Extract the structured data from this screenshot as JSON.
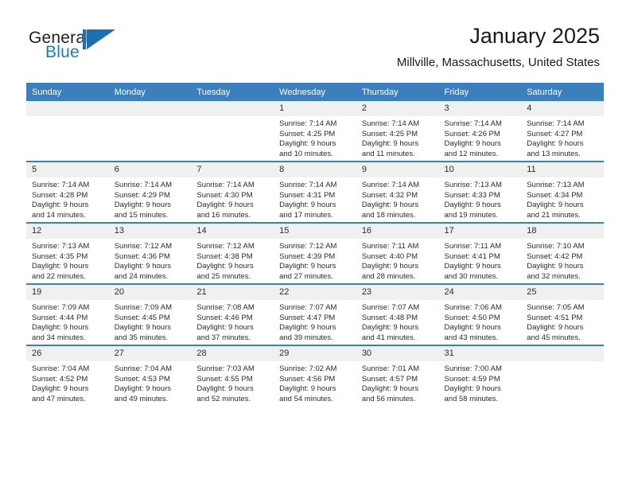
{
  "brand": {
    "name_part1": "General",
    "name_part2": "Blue",
    "logo_icon": "blue-triangle-flag-icon",
    "accent_color": "#1c7cc4"
  },
  "header": {
    "title": "January 2025",
    "subtitle": "Millville, Massachusetts, United States",
    "header_bg_color": "#3b7fbf",
    "daynum_bg_color": "#f0f0f0"
  },
  "weekday_headers": [
    "Sunday",
    "Monday",
    "Tuesday",
    "Wednesday",
    "Thursday",
    "Friday",
    "Saturday"
  ],
  "weeks": [
    [
      {
        "day": "",
        "empty": true,
        "sunrise": "",
        "sunset": "",
        "daylight_line1": "",
        "daylight_line2": ""
      },
      {
        "day": "",
        "empty": true,
        "sunrise": "",
        "sunset": "",
        "daylight_line1": "",
        "daylight_line2": ""
      },
      {
        "day": "",
        "empty": true,
        "sunrise": "",
        "sunset": "",
        "daylight_line1": "",
        "daylight_line2": ""
      },
      {
        "day": "1",
        "empty": false,
        "sunrise": "Sunrise: 7:14 AM",
        "sunset": "Sunset: 4:25 PM",
        "daylight_line1": "Daylight: 9 hours",
        "daylight_line2": "and 10 minutes."
      },
      {
        "day": "2",
        "empty": false,
        "sunrise": "Sunrise: 7:14 AM",
        "sunset": "Sunset: 4:25 PM",
        "daylight_line1": "Daylight: 9 hours",
        "daylight_line2": "and 11 minutes."
      },
      {
        "day": "3",
        "empty": false,
        "sunrise": "Sunrise: 7:14 AM",
        "sunset": "Sunset: 4:26 PM",
        "daylight_line1": "Daylight: 9 hours",
        "daylight_line2": "and 12 minutes."
      },
      {
        "day": "4",
        "empty": false,
        "sunrise": "Sunrise: 7:14 AM",
        "sunset": "Sunset: 4:27 PM",
        "daylight_line1": "Daylight: 9 hours",
        "daylight_line2": "and 13 minutes."
      }
    ],
    [
      {
        "day": "5",
        "empty": false,
        "sunrise": "Sunrise: 7:14 AM",
        "sunset": "Sunset: 4:28 PM",
        "daylight_line1": "Daylight: 9 hours",
        "daylight_line2": "and 14 minutes."
      },
      {
        "day": "6",
        "empty": false,
        "sunrise": "Sunrise: 7:14 AM",
        "sunset": "Sunset: 4:29 PM",
        "daylight_line1": "Daylight: 9 hours",
        "daylight_line2": "and 15 minutes."
      },
      {
        "day": "7",
        "empty": false,
        "sunrise": "Sunrise: 7:14 AM",
        "sunset": "Sunset: 4:30 PM",
        "daylight_line1": "Daylight: 9 hours",
        "daylight_line2": "and 16 minutes."
      },
      {
        "day": "8",
        "empty": false,
        "sunrise": "Sunrise: 7:14 AM",
        "sunset": "Sunset: 4:31 PM",
        "daylight_line1": "Daylight: 9 hours",
        "daylight_line2": "and 17 minutes."
      },
      {
        "day": "9",
        "empty": false,
        "sunrise": "Sunrise: 7:14 AM",
        "sunset": "Sunset: 4:32 PM",
        "daylight_line1": "Daylight: 9 hours",
        "daylight_line2": "and 18 minutes."
      },
      {
        "day": "10",
        "empty": false,
        "sunrise": "Sunrise: 7:13 AM",
        "sunset": "Sunset: 4:33 PM",
        "daylight_line1": "Daylight: 9 hours",
        "daylight_line2": "and 19 minutes."
      },
      {
        "day": "11",
        "empty": false,
        "sunrise": "Sunrise: 7:13 AM",
        "sunset": "Sunset: 4:34 PM",
        "daylight_line1": "Daylight: 9 hours",
        "daylight_line2": "and 21 minutes."
      }
    ],
    [
      {
        "day": "12",
        "empty": false,
        "sunrise": "Sunrise: 7:13 AM",
        "sunset": "Sunset: 4:35 PM",
        "daylight_line1": "Daylight: 9 hours",
        "daylight_line2": "and 22 minutes."
      },
      {
        "day": "13",
        "empty": false,
        "sunrise": "Sunrise: 7:12 AM",
        "sunset": "Sunset: 4:36 PM",
        "daylight_line1": "Daylight: 9 hours",
        "daylight_line2": "and 24 minutes."
      },
      {
        "day": "14",
        "empty": false,
        "sunrise": "Sunrise: 7:12 AM",
        "sunset": "Sunset: 4:38 PM",
        "daylight_line1": "Daylight: 9 hours",
        "daylight_line2": "and 25 minutes."
      },
      {
        "day": "15",
        "empty": false,
        "sunrise": "Sunrise: 7:12 AM",
        "sunset": "Sunset: 4:39 PM",
        "daylight_line1": "Daylight: 9 hours",
        "daylight_line2": "and 27 minutes."
      },
      {
        "day": "16",
        "empty": false,
        "sunrise": "Sunrise: 7:11 AM",
        "sunset": "Sunset: 4:40 PM",
        "daylight_line1": "Daylight: 9 hours",
        "daylight_line2": "and 28 minutes."
      },
      {
        "day": "17",
        "empty": false,
        "sunrise": "Sunrise: 7:11 AM",
        "sunset": "Sunset: 4:41 PM",
        "daylight_line1": "Daylight: 9 hours",
        "daylight_line2": "and 30 minutes."
      },
      {
        "day": "18",
        "empty": false,
        "sunrise": "Sunrise: 7:10 AM",
        "sunset": "Sunset: 4:42 PM",
        "daylight_line1": "Daylight: 9 hours",
        "daylight_line2": "and 32 minutes."
      }
    ],
    [
      {
        "day": "19",
        "empty": false,
        "sunrise": "Sunrise: 7:09 AM",
        "sunset": "Sunset: 4:44 PM",
        "daylight_line1": "Daylight: 9 hours",
        "daylight_line2": "and 34 minutes."
      },
      {
        "day": "20",
        "empty": false,
        "sunrise": "Sunrise: 7:09 AM",
        "sunset": "Sunset: 4:45 PM",
        "daylight_line1": "Daylight: 9 hours",
        "daylight_line2": "and 35 minutes."
      },
      {
        "day": "21",
        "empty": false,
        "sunrise": "Sunrise: 7:08 AM",
        "sunset": "Sunset: 4:46 PM",
        "daylight_line1": "Daylight: 9 hours",
        "daylight_line2": "and 37 minutes."
      },
      {
        "day": "22",
        "empty": false,
        "sunrise": "Sunrise: 7:07 AM",
        "sunset": "Sunset: 4:47 PM",
        "daylight_line1": "Daylight: 9 hours",
        "daylight_line2": "and 39 minutes."
      },
      {
        "day": "23",
        "empty": false,
        "sunrise": "Sunrise: 7:07 AM",
        "sunset": "Sunset: 4:48 PM",
        "daylight_line1": "Daylight: 9 hours",
        "daylight_line2": "and 41 minutes."
      },
      {
        "day": "24",
        "empty": false,
        "sunrise": "Sunrise: 7:06 AM",
        "sunset": "Sunset: 4:50 PM",
        "daylight_line1": "Daylight: 9 hours",
        "daylight_line2": "and 43 minutes."
      },
      {
        "day": "25",
        "empty": false,
        "sunrise": "Sunrise: 7:05 AM",
        "sunset": "Sunset: 4:51 PM",
        "daylight_line1": "Daylight: 9 hours",
        "daylight_line2": "and 45 minutes."
      }
    ],
    [
      {
        "day": "26",
        "empty": false,
        "sunrise": "Sunrise: 7:04 AM",
        "sunset": "Sunset: 4:52 PM",
        "daylight_line1": "Daylight: 9 hours",
        "daylight_line2": "and 47 minutes."
      },
      {
        "day": "27",
        "empty": false,
        "sunrise": "Sunrise: 7:04 AM",
        "sunset": "Sunset: 4:53 PM",
        "daylight_line1": "Daylight: 9 hours",
        "daylight_line2": "and 49 minutes."
      },
      {
        "day": "28",
        "empty": false,
        "sunrise": "Sunrise: 7:03 AM",
        "sunset": "Sunset: 4:55 PM",
        "daylight_line1": "Daylight: 9 hours",
        "daylight_line2": "and 52 minutes."
      },
      {
        "day": "29",
        "empty": false,
        "sunrise": "Sunrise: 7:02 AM",
        "sunset": "Sunset: 4:56 PM",
        "daylight_line1": "Daylight: 9 hours",
        "daylight_line2": "and 54 minutes."
      },
      {
        "day": "30",
        "empty": false,
        "sunrise": "Sunrise: 7:01 AM",
        "sunset": "Sunset: 4:57 PM",
        "daylight_line1": "Daylight: 9 hours",
        "daylight_line2": "and 56 minutes."
      },
      {
        "day": "31",
        "empty": false,
        "sunrise": "Sunrise: 7:00 AM",
        "sunset": "Sunset: 4:59 PM",
        "daylight_line1": "Daylight: 9 hours",
        "daylight_line2": "and 58 minutes."
      },
      {
        "day": "",
        "empty": true,
        "sunrise": "",
        "sunset": "",
        "daylight_line1": "",
        "daylight_line2": ""
      }
    ]
  ]
}
